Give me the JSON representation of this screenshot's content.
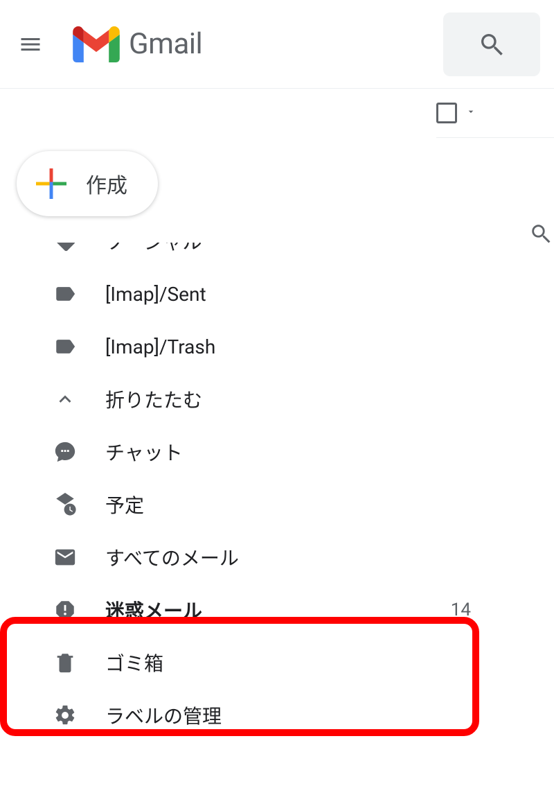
{
  "header": {
    "app_name": "Gmail"
  },
  "compose": {
    "label": "作成"
  },
  "sidebar": {
    "cutoff_item": {
      "label": "ソーシャル"
    },
    "items": [
      {
        "icon": "label",
        "label": "[Imap]/Sent"
      },
      {
        "icon": "label",
        "label": "[Imap]/Trash"
      },
      {
        "icon": "collapse",
        "label": "折りたたむ"
      },
      {
        "icon": "chat",
        "label": "チャット"
      },
      {
        "icon": "schedule",
        "label": "予定"
      },
      {
        "icon": "mail",
        "label": "すべてのメール"
      },
      {
        "icon": "spam",
        "label": "迷惑メール",
        "count": 14,
        "bold": true
      },
      {
        "icon": "trash",
        "label": "ゴミ箱"
      },
      {
        "icon": "settings",
        "label": "ラベルの管理"
      }
    ]
  }
}
